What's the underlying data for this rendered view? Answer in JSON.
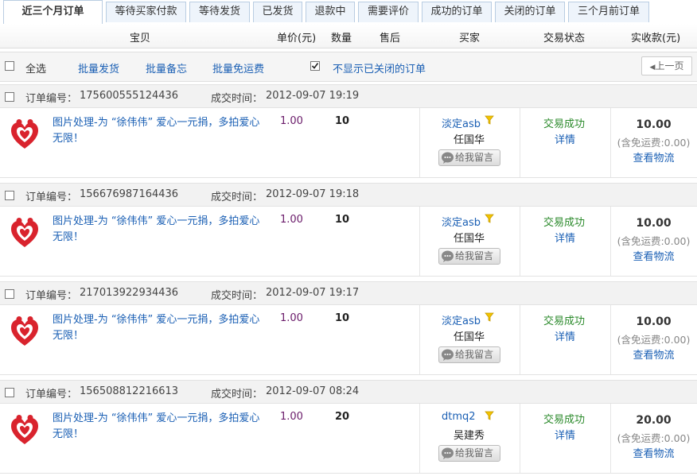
{
  "tabs": [
    "近三个月订单",
    "等待买家付款",
    "等待发货",
    "已发货",
    "退款中",
    "需要评价",
    "成功的订单",
    "关闭的订单",
    "三个月前订单"
  ],
  "header": {
    "item": "宝贝",
    "price": "单价(元)",
    "qty": "数量",
    "after_sale": "售后",
    "buyer": "买家",
    "status": "交易状态",
    "received": "实收款(元)"
  },
  "toolbar": {
    "select_all": "全选",
    "batch_ship": "批量发货",
    "batch_memo": "批量备忘",
    "batch_free_ship": "批量免运费",
    "hide_closed": "不显示已关闭的订单",
    "prev_page": "上一页"
  },
  "orders": [
    {
      "order_label": "订单编号：",
      "order_no": "175600555124436",
      "time_label": "成交时间：",
      "time": "2012-09-07 19:19",
      "title": "图片处理-为 “徐伟伟” 爱心一元捐，多拍爱心无限！",
      "price": "1.00",
      "qty": "10",
      "buyer": "淡定asb",
      "real_name": "任国华",
      "message": "给我留言",
      "status": "交易成功",
      "detail": "详情",
      "total": "10.00",
      "ship_note": "(含免运费:0.00)",
      "logistics": "查看物流"
    },
    {
      "order_label": "订单编号：",
      "order_no": "156676987164436",
      "time_label": "成交时间：",
      "time": "2012-09-07 19:18",
      "title": "图片处理-为 “徐伟伟” 爱心一元捐，多拍爱心无限！",
      "price": "1.00",
      "qty": "10",
      "buyer": "淡定asb",
      "real_name": "任国华",
      "message": "给我留言",
      "status": "交易成功",
      "detail": "详情",
      "total": "10.00",
      "ship_note": "(含免运费:0.00)",
      "logistics": "查看物流"
    },
    {
      "order_label": "订单编号：",
      "order_no": "217013922934436",
      "time_label": "成交时间：",
      "time": "2012-09-07 19:17",
      "title": "图片处理-为 “徐伟伟” 爱心一元捐，多拍爱心无限！",
      "price": "1.00",
      "qty": "10",
      "buyer": "淡定asb",
      "real_name": "任国华",
      "message": "给我留言",
      "status": "交易成功",
      "detail": "详情",
      "total": "10.00",
      "ship_note": "(含免运费:0.00)",
      "logistics": "查看物流"
    },
    {
      "order_label": "订单编号：",
      "order_no": "156508812216613",
      "time_label": "成交时间：",
      "time": "2012-09-07 08:24",
      "title": "图片处理-为 “徐伟伟” 爱心一元捐，多拍爱心无限！",
      "price": "1.00",
      "qty": "20",
      "buyer": "dtmq2",
      "real_name": "吴建秀",
      "message": "给我留言",
      "status": "交易成功",
      "detail": "详情",
      "total": "20.00",
      "ship_note": "(含免运费:0.00)",
      "logistics": "查看物流"
    }
  ],
  "colors": {
    "link": "#1a5fb4",
    "success": "#2b8a2b",
    "price": "#6a1b6a",
    "logo_red": "#d9232d"
  }
}
